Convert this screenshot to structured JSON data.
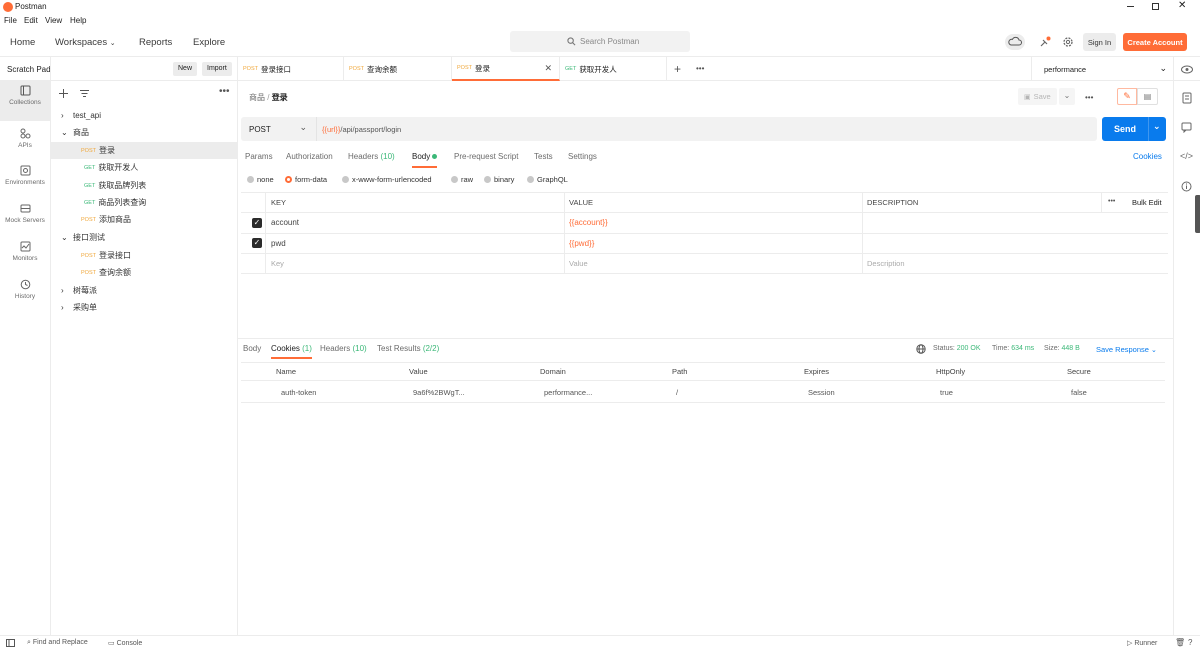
{
  "window": {
    "title": "Postman"
  },
  "menu": [
    "File",
    "Edit",
    "View",
    "Help"
  ],
  "header": {
    "nav": [
      "Home",
      "Workspaces",
      "Reports",
      "Explore"
    ],
    "search_placeholder": "Search Postman",
    "sign_in": "Sign In",
    "create_account": "Create Account",
    "accent": "#ff6c37"
  },
  "sidebar": {
    "workspace": "Scratch Pad",
    "new_label": "New",
    "import_label": "Import",
    "rail": [
      "Collections",
      "APIs",
      "Environments",
      "Mock Servers",
      "Monitors",
      "History"
    ],
    "tree": [
      {
        "label": "test_api",
        "type": "folder",
        "expanded": false
      },
      {
        "label": "商品",
        "type": "folder",
        "expanded": true
      },
      {
        "method": "POST",
        "label": "登录",
        "type": "request",
        "selected": true
      },
      {
        "method": "GET",
        "label": "获取开发人",
        "type": "request"
      },
      {
        "method": "GET",
        "label": "获取品牌列表",
        "type": "request"
      },
      {
        "method": "GET",
        "label": "商品列表查询",
        "type": "request"
      },
      {
        "method": "POST",
        "label": "添加商品",
        "type": "request"
      },
      {
        "label": "接口测试",
        "type": "folder",
        "expanded": true
      },
      {
        "method": "POST",
        "label": "登录接口",
        "type": "request"
      },
      {
        "method": "POST",
        "label": "查询余额",
        "type": "request"
      },
      {
        "label": "树莓派",
        "type": "folder",
        "expanded": false
      },
      {
        "label": "采购单",
        "type": "folder",
        "expanded": false
      }
    ]
  },
  "tabs": [
    {
      "method": "POST",
      "label": "登录接口"
    },
    {
      "method": "POST",
      "label": "查询余额"
    },
    {
      "method": "POST",
      "label": "登录",
      "active": true
    },
    {
      "method": "GET",
      "label": "获取开发人"
    }
  ],
  "environment": "performance",
  "request": {
    "breadcrumb_parent": "商品",
    "breadcrumb_current": "登录",
    "save_label": "Save",
    "method": "POST",
    "url_var": "{{url}}",
    "url_path": "/api/passport/login",
    "send_label": "Send",
    "subtabs": [
      "Params",
      "Authorization",
      "Headers",
      "(10)",
      "Body",
      "Pre-request Script",
      "Tests",
      "Settings"
    ],
    "cookies_link": "Cookies",
    "body_types": [
      "none",
      "form-data",
      "x-www-form-urlencoded",
      "raw",
      "binary",
      "GraphQL"
    ],
    "table_headers": {
      "key": "KEY",
      "value": "VALUE",
      "description": "DESCRIPTION",
      "bulk_edit": "Bulk Edit"
    },
    "rows": [
      {
        "key": "account",
        "value": "{{account}}",
        "checked": true
      },
      {
        "key": "pwd",
        "value": "{{pwd}}",
        "checked": true
      }
    ],
    "placeholder": {
      "key": "Key",
      "value": "Value",
      "description": "Description"
    }
  },
  "response": {
    "tabs": [
      "Body",
      "Cookies",
      "(1)",
      "Headers",
      "(10)",
      "Test Results",
      "(2/2)"
    ],
    "status_label": "Status:",
    "status": "200 OK",
    "time_label": "Time:",
    "time": "634 ms",
    "size_label": "Size:",
    "size": "448 B",
    "save_response": "Save Response",
    "columns": [
      "Name",
      "Value",
      "Domain",
      "Path",
      "Expires",
      "HttpOnly",
      "Secure"
    ],
    "cookies": [
      [
        "auth-token",
        "9a6f%2BWgT...",
        "performance...",
        "/",
        "Session",
        "true",
        "false"
      ]
    ]
  },
  "statusbar": {
    "find_replace": "Find and Replace",
    "console": "Console",
    "runner": "Runner"
  }
}
